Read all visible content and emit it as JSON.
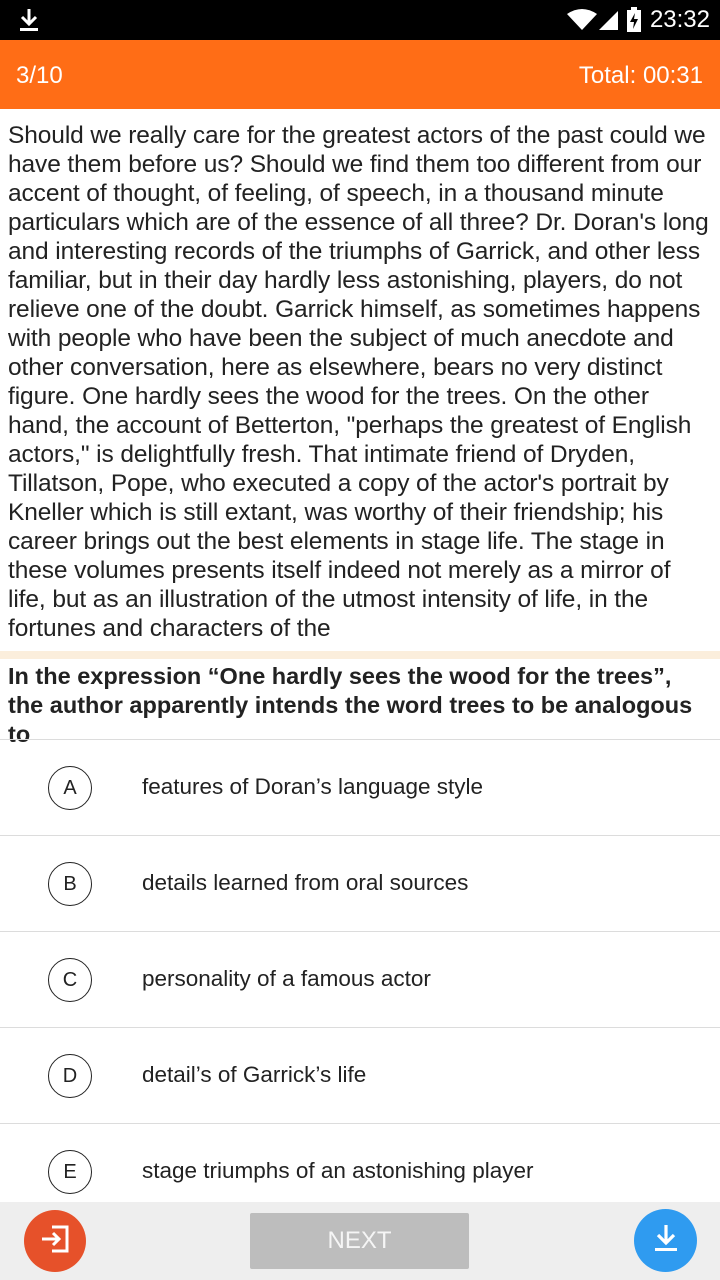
{
  "status_bar": {
    "time": "23:32",
    "icons": [
      "download-icon",
      "wifi-icon",
      "signal-icon",
      "battery-charging-icon"
    ]
  },
  "header": {
    "progress": "3/10",
    "timer": "Total: 00:31",
    "background_color": "#ff6d16"
  },
  "passage": {
    "text": "Should we really care for the greatest actors of the past could we have them before us? Should we find them too different from our accent of thought, of feeling, of speech, in a thousand minute particulars which are of the essence of all three? Dr. Doran's long and interesting records of the triumphs of Garrick, and other less familiar, but in their day hardly less astonishing, players, do not relieve one of the doubt. Garrick himself, as sometimes happens with people who have been the subject of much anecdote and other conversation, here as elsewhere, bears no very distinct figure. One hardly sees the wood for the trees. On the other hand, the account of Betterton, \"perhaps the greatest of English actors,\" is delightfully fresh. That intimate friend of Dryden, Tillatson, Pope, who executed a copy of the actor's portrait by Kneller which is still extant, was worthy of their friendship; his career brings out the best elements in stage life. The stage in these volumes presents itself indeed not merely as a mirror of life, but as an illustration of the utmost intensity of life, in the fortunes and characters of the"
  },
  "question": {
    "text": "In the expression “One hardly sees the wood for the trees”, the author apparently intends the word trees to be analogous to"
  },
  "options": [
    {
      "letter": "A",
      "text": "features of Doran’s language style"
    },
    {
      "letter": "B",
      "text": "details learned from oral sources"
    },
    {
      "letter": "C",
      "text": "personality of a famous actor"
    },
    {
      "letter": "D",
      "text": "detail’s of Garrick’s life"
    },
    {
      "letter": "E",
      "text": "stage triumphs of an astonishing player"
    }
  ],
  "bottom_bar": {
    "next_label": "NEXT",
    "exit_icon": "exit-icon",
    "download_icon": "download-icon",
    "exit_color": "#e6512a",
    "download_color": "#2f9bf0"
  }
}
